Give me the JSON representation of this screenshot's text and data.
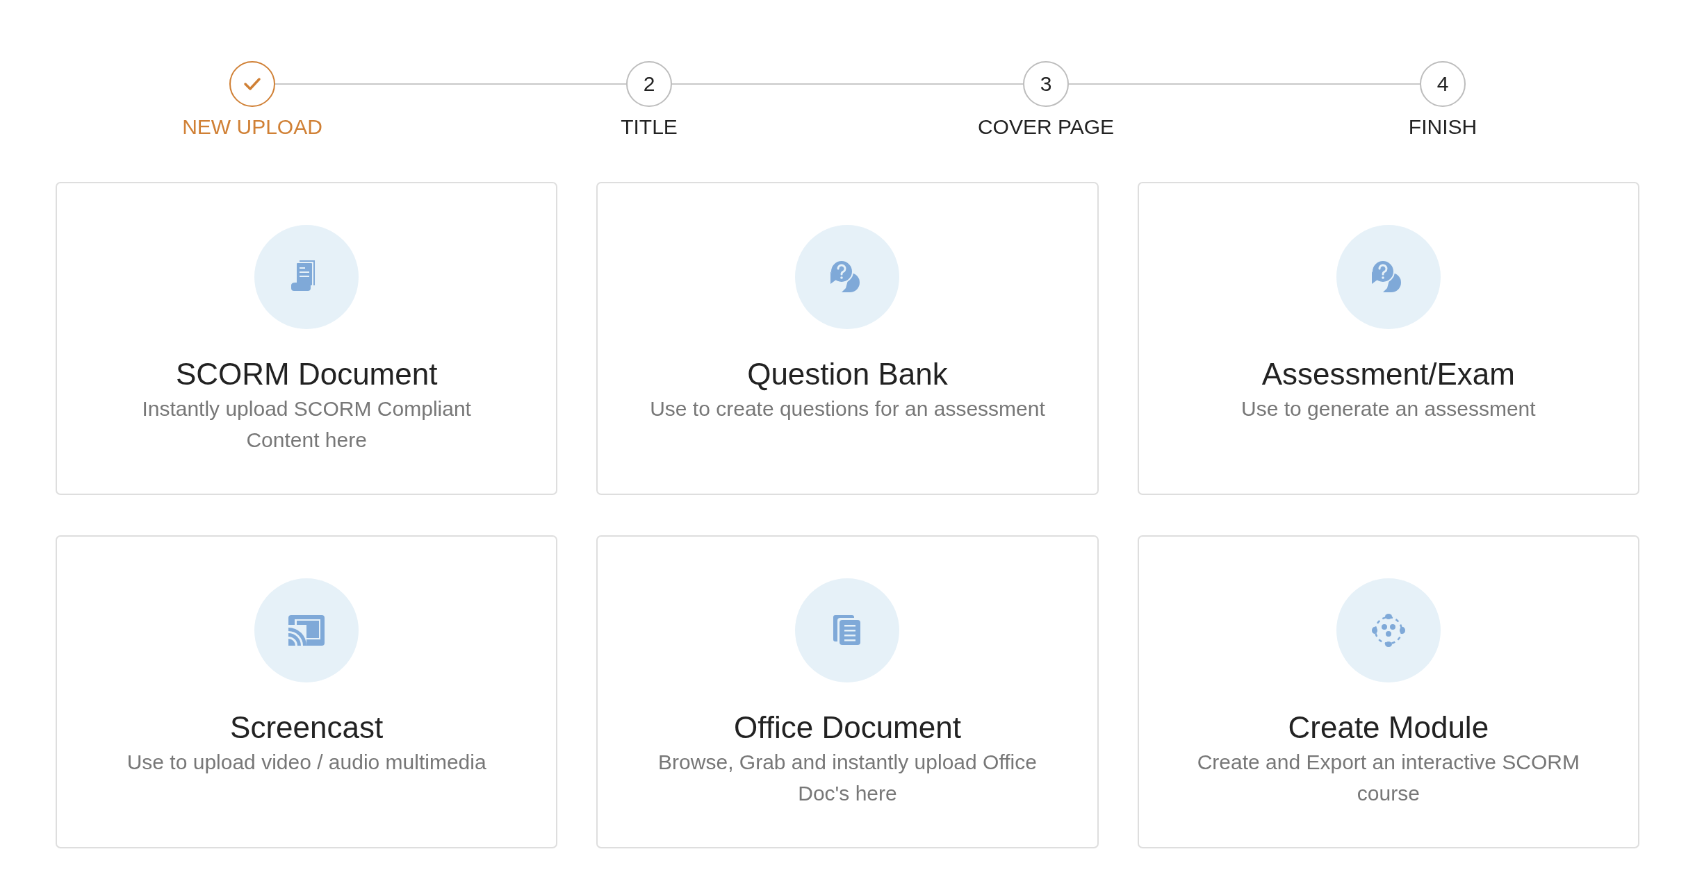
{
  "steps": [
    {
      "label": "NEW UPLOAD",
      "completed": true
    },
    {
      "number": "2",
      "label": "TITLE",
      "completed": false
    },
    {
      "number": "3",
      "label": "COVER PAGE",
      "completed": false
    },
    {
      "number": "4",
      "label": "FINISH",
      "completed": false
    }
  ],
  "cards": [
    {
      "kind": "document",
      "title": "SCORM Document",
      "description": "Instantly upload SCORM Compliant Content here"
    },
    {
      "kind": "question",
      "title": "Question Bank",
      "description": "Use to create questions for an assessment"
    },
    {
      "kind": "question",
      "title": "Assessment/Exam",
      "description": "Use to generate an assessment"
    },
    {
      "kind": "cast",
      "title": "Screencast",
      "description": "Use to upload video / audio multimedia"
    },
    {
      "kind": "copy",
      "title": "Office Document",
      "description": "Browse, Grab and instantly upload Office Doc's here"
    },
    {
      "kind": "module",
      "title": "Create Module",
      "description": "Create and Export an interactive SCORM course"
    }
  ]
}
